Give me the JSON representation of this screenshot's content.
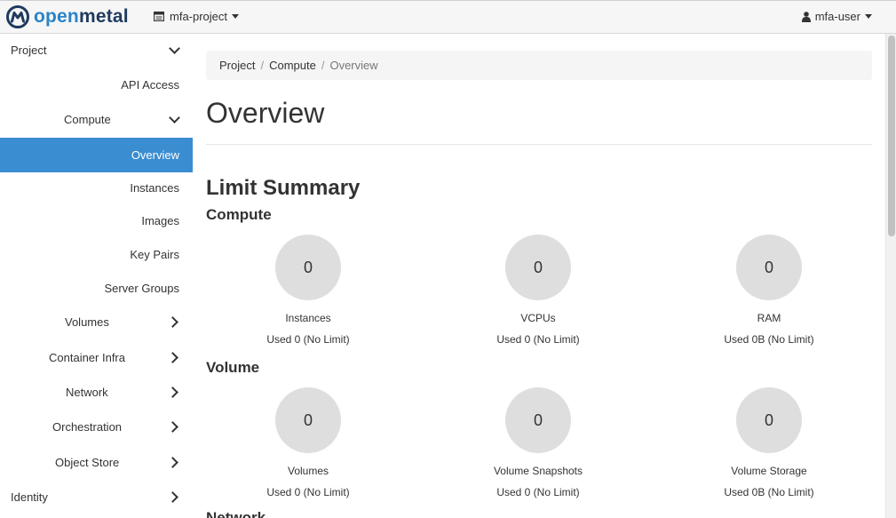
{
  "brand": {
    "open": "open",
    "metal": "metal"
  },
  "header": {
    "project": "mfa-project",
    "user": "mfa-user"
  },
  "sidebar": {
    "project": "Project",
    "api_access": "API Access",
    "compute": "Compute",
    "overview": "Overview",
    "instances": "Instances",
    "images": "Images",
    "key_pairs": "Key Pairs",
    "server_groups": "Server Groups",
    "volumes": "Volumes",
    "container_infra": "Container Infra",
    "network": "Network",
    "orchestration": "Orchestration",
    "object_store": "Object Store",
    "identity": "Identity"
  },
  "breadcrumb": {
    "project": "Project",
    "compute": "Compute",
    "overview": "Overview",
    "sep": "/"
  },
  "page_title": "Overview",
  "limit_summary": "Limit Summary",
  "sections": {
    "compute": "Compute",
    "volume": "Volume",
    "network": "Network"
  },
  "compute_pies": [
    {
      "value": "0",
      "label": "Instances",
      "used": "Used 0 (No Limit)"
    },
    {
      "value": "0",
      "label": "VCPUs",
      "used": "Used 0 (No Limit)"
    },
    {
      "value": "0",
      "label": "RAM",
      "used": "Used 0B (No Limit)"
    }
  ],
  "volume_pies": [
    {
      "value": "0",
      "label": "Volumes",
      "used": "Used 0 (No Limit)"
    },
    {
      "value": "0",
      "label": "Volume Snapshots",
      "used": "Used 0 (No Limit)"
    },
    {
      "value": "0",
      "label": "Volume Storage",
      "used": "Used 0B (No Limit)"
    }
  ],
  "colors": {
    "active": "#3a8dd0",
    "brand_blue": "#2a83c7",
    "brand_dark": "#1f3a5f",
    "pie_bg": "#dedede"
  }
}
